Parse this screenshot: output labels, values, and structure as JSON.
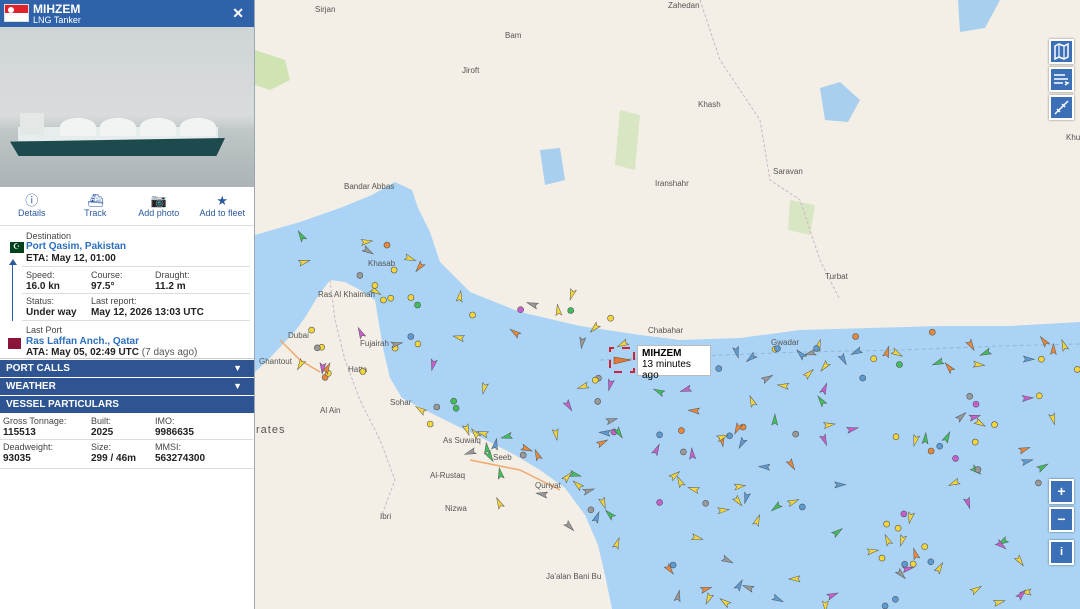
{
  "vessel": {
    "name": "MIHZEM",
    "type": "LNG Tanker",
    "close_icon": "close-icon"
  },
  "actions": [
    {
      "label": "Details",
      "icon": "info-icon"
    },
    {
      "label": "Track",
      "icon": "ship-icon"
    },
    {
      "label": "Add photo",
      "icon": "camera-icon"
    },
    {
      "label": "Add to fleet",
      "icon": "star-icon"
    }
  ],
  "route": {
    "destination_label": "Destination",
    "destination": "Port Qasim, Pakistan",
    "eta": "ETA: May 12, 01:00",
    "speed_label": "Speed:",
    "speed": "16.0 kn",
    "course_label": "Course:",
    "course": "97.5°",
    "draught_label": "Draught:",
    "draught": "11.2 m",
    "status_label": "Status:",
    "status": "Under way",
    "last_report_label": "Last report:",
    "last_report": "May 12, 2026 13:03 UTC",
    "last_port_label": "Last Port",
    "last_port": "Ras Laffan Anch., Qatar",
    "ata": "ATA: May 05, 02:49 UTC",
    "ata_ago": "(7 days ago)"
  },
  "sections": {
    "port_calls": "PORT CALLS",
    "weather": "WEATHER",
    "particulars": "VESSEL PARTICULARS"
  },
  "particulars": {
    "gross_tonnage_label": "Gross Tonnage:",
    "gross_tonnage": "115513",
    "built_label": "Built:",
    "built": "2025",
    "imo_label": "IMO:",
    "imo": "9986635",
    "deadweight_label": "Deadweight:",
    "deadweight": "93035",
    "size_label": "Size:",
    "size": "299 / 46m",
    "mmsi_label": "MMSI:",
    "mmsi": "563274300"
  },
  "map": {
    "tooltip_name": "MIHZEM",
    "tooltip_time": "13 minutes ago",
    "places": [
      "Sirjan",
      "Zahedan",
      "Bam",
      "Jiroft",
      "Khash",
      "Iranshahr",
      "Saravan",
      "Turbat",
      "Bandar Abbas",
      "Khasab",
      "Ras Al Khaimah",
      "Fujairah",
      "Dubai",
      "Hatta",
      "Ghantout",
      "Sohar",
      "Al Ain",
      "Chabahar",
      "Gwadar",
      "Khu",
      "Seeb",
      "As Suwaiq",
      "Al-Rustaq",
      "Quriyat",
      "Ibri",
      "Nizwa",
      "Ja'alan Bani Bu",
      "rates"
    ],
    "controls": [
      "map-layers-icon",
      "weather-icon",
      "measure-icon"
    ],
    "zoom_in": "+",
    "zoom_out": "−",
    "info": "i"
  },
  "colors": {
    "sea": "#aad3f5",
    "land": "#f2efe6",
    "header": "#2f62a8",
    "section_bar": "#2e5492",
    "link": "#2c6fbf"
  }
}
